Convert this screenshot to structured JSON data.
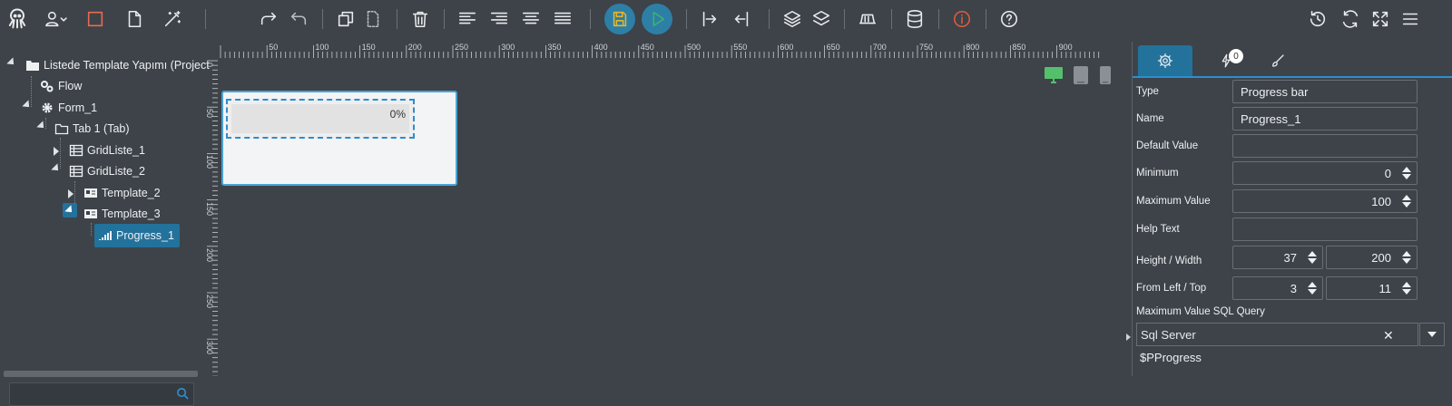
{
  "toolbar": {
    "icons": [
      "octopus-logo-icon",
      "user-menu-icon",
      "square-icon",
      "page-icon",
      "magic-wand-icon",
      "redo-icon",
      "undo-icon",
      "copy-icon",
      "paste-icon",
      "delete-icon",
      "align-left-icon",
      "align-right-icon",
      "align-center-icon",
      "align-justify-icon",
      "save-icon",
      "run-icon",
      "move-right-icon",
      "move-left-icon",
      "layer-up-icon",
      "layer-down-icon",
      "resize-icon",
      "database-icon",
      "info-icon",
      "help-icon",
      "history-icon",
      "refresh-icon",
      "fullscreen-icon",
      "menu-icon"
    ]
  },
  "tree": {
    "root": "Listede Template Yapımı (Project",
    "flow": "Flow",
    "form": "Form_1",
    "tab": "Tab 1 (Tab)",
    "grid1": "GridListe_1",
    "grid2": "GridListe_2",
    "tpl2": "Template_2",
    "tpl3": "Template_3",
    "progress": "Progress_1"
  },
  "ruler": {
    "top": [
      "50",
      "100",
      "150",
      "200",
      "250",
      "300",
      "350",
      "400",
      "450",
      "500",
      "550",
      "600",
      "650",
      "700",
      "750",
      "800",
      "850",
      "900"
    ],
    "left": [
      "0",
      "50",
      "100",
      "150",
      "200",
      "250",
      "300"
    ]
  },
  "canvas": {
    "progress_percent": "0%",
    "progress_value": 0
  },
  "panel": {
    "tabs": {
      "badge": "0"
    },
    "type_label": "Type",
    "type_value": "Progress bar",
    "name_label": "Name",
    "name_value": "Progress_1",
    "default_label": "Default Value",
    "default_value": "",
    "min_label": "Minimum",
    "min_value": "0",
    "max_label": "Maximum Value",
    "max_value": "100",
    "help_label": "Help Text",
    "help_value": "",
    "hw_label": "Height / Width",
    "height_value": "37",
    "width_value": "200",
    "lt_label": "From Left / Top",
    "left_value": "3",
    "top_value": "11",
    "sql_label": "Maximum Value SQL Query",
    "sql_server": "Sql Server",
    "sql_clear": "✕",
    "sql_text": "$PProgress"
  },
  "colors": {
    "accent": "#23729c",
    "selection": "#2f8ccc",
    "save": "#e4b62c",
    "run": "#3bb36b",
    "info": "#e05a3c",
    "device_active": "#55c06b"
  }
}
